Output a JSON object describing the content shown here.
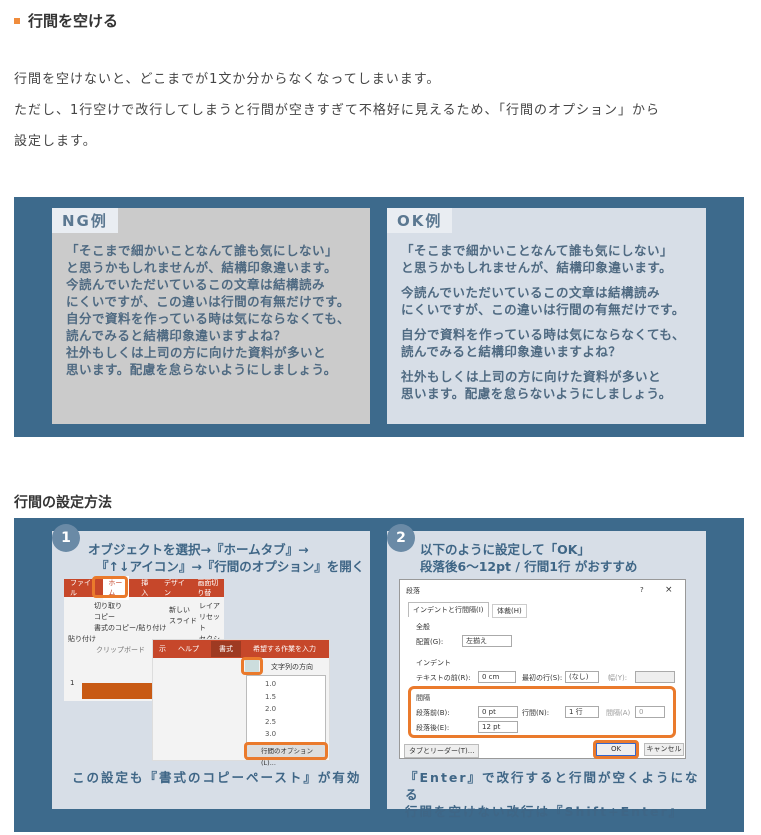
{
  "heading": "行間を空ける",
  "paragraphs": [
    "行間を空けないと、どこまでが1文か分からなくなってしまいます。",
    "ただし、1行空けで改行してしまうと行間が空きすぎて不格好に見えるため、「行間のオプション」から",
    "設定します。"
  ],
  "ng": {
    "tag": "NG例",
    "lines": [
      "「そこまで細かいことなんて誰も気にしない」",
      "と思うかもしれませんが、結構印象違います。",
      "今読んでいただいているこの文章は結構読み",
      "にくいですが、この違いは行間の有無だけです。",
      "自分で資料を作っている時は気にならなくても、",
      "読んでみると結構印象違いますよね？",
      "社外もしくは上司の方に向けた資料が多いと",
      "思います。配慮を怠らないようにしましょう。"
    ]
  },
  "ok": {
    "tag": "OK例",
    "paras": [
      [
        "「そこまで細かいことなんて誰も気にしない」",
        "と思うかもしれませんが、結構印象違います。"
      ],
      [
        "今読んでいただいているこの文章は結構読み",
        "にくいですが、この違いは行間の有無だけです。"
      ],
      [
        "自分で資料を作っている時は気にならなくても、",
        "読んでみると結構印象違いますよね？"
      ],
      [
        "社外もしくは上司の方に向けた資料が多いと",
        "思います。配慮を怠らないようにしましょう。"
      ]
    ]
  },
  "method_heading": "行間の設定方法",
  "step1": {
    "num": "1",
    "title": [
      "オブジェクトを選択→『ホームタブ』→",
      "『↑↓アイコン』→『行間のオプション』を開く"
    ],
    "caption": "この設定も『書式のコピーペースト』が有効",
    "ribbon_tabs": [
      "ファイル",
      "ホーム",
      "挿入",
      "デザイン",
      "画面切り替"
    ],
    "clip": [
      "切り取り",
      "コピー",
      "書式のコピー/貼り付け",
      "貼り付け",
      "クリップボード",
      "新しい",
      "スライド",
      "レイア",
      "リセット",
      "セクシ"
    ],
    "ribbon2_tabs": [
      "示",
      "ヘルプ",
      "書式",
      "希望する作業を入力"
    ],
    "text_dir": "文字列の方向",
    "spacing_options": [
      "1.0",
      "1.5",
      "2.0",
      "2.5",
      "3.0"
    ],
    "option_label": "行間のオプション(L)...",
    "slide_num": "1"
  },
  "step2": {
    "num": "2",
    "title": [
      "以下のように設定して「OK」",
      "段落後6〜12pt / 行間1行 がおすすめ"
    ],
    "caption": [
      "『Enter』で改行すると行間が空くようになる",
      "行間を空けない改行は『Shift+Enter』"
    ],
    "dialog": {
      "title": "段落",
      "help": "?",
      "close": "×",
      "tabs": [
        "インデントと行間隔(I)",
        "体裁(H)"
      ],
      "general": "全般",
      "align_label": "配置(G):",
      "align_value": "左揃え",
      "indent": "インデント",
      "before_text_label": "テキストの前(R):",
      "before_text_value": "0 cm",
      "first_line_label": "最初の行(S):",
      "first_line_value": "(なし)",
      "width_label": "幅(Y):",
      "spacing": "間隔",
      "before_label": "段落前(B):",
      "before_value": "0 pt",
      "line_label": "行間(N):",
      "line_value": "1 行",
      "interval_label": "間隔(A)",
      "interval_value": "0",
      "after_label": "段落後(E):",
      "after_value": "12 pt",
      "tabs_button": "タブとリーダー(T)...",
      "ok": "OK",
      "cancel": "キャンセル"
    }
  }
}
